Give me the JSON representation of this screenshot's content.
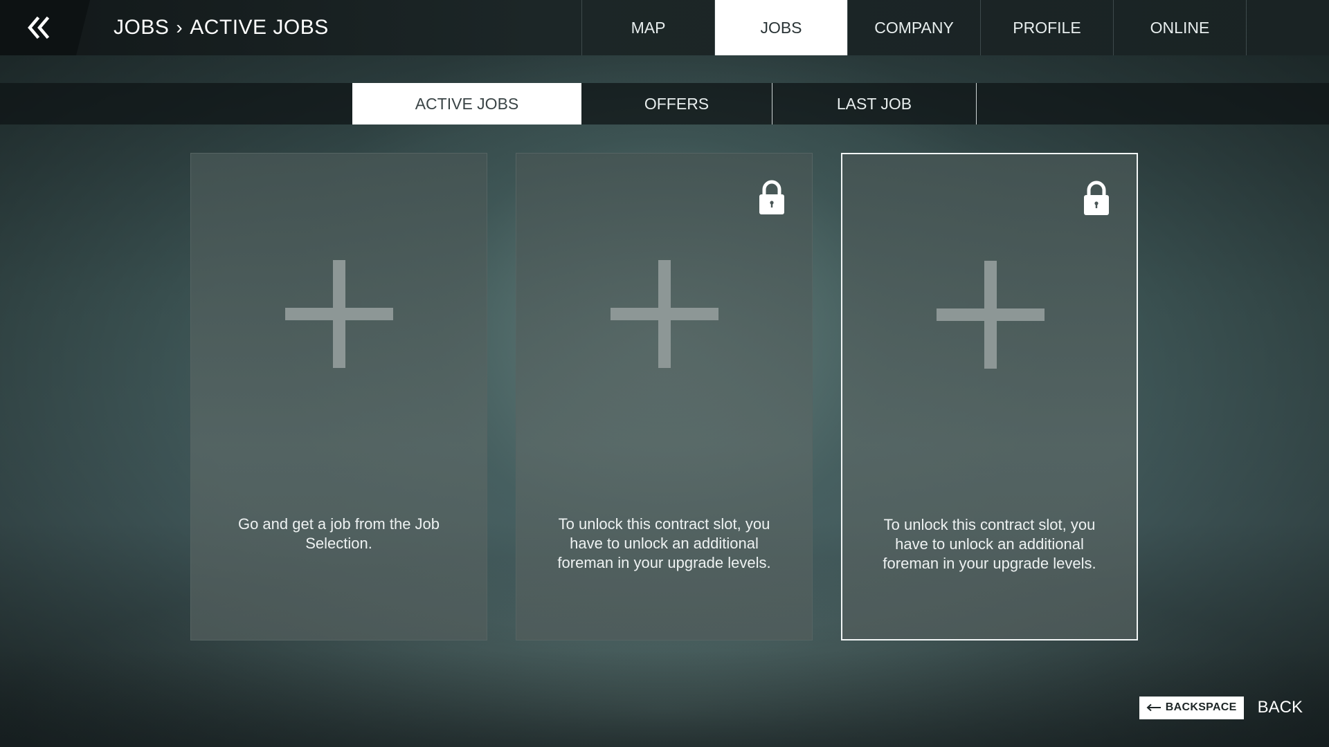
{
  "header": {
    "breadcrumb": [
      "JOBS",
      "ACTIVE JOBS"
    ],
    "breadcrumb_sep": "›",
    "tabs": [
      {
        "label": "MAP"
      },
      {
        "label": "JOBS",
        "active": true
      },
      {
        "label": "COMPANY"
      },
      {
        "label": "PROFILE"
      },
      {
        "label": "ONLINE"
      }
    ]
  },
  "subtabs": [
    {
      "label": "ACTIVE JOBS",
      "active": true
    },
    {
      "label": "OFFERS"
    },
    {
      "label": "LAST JOB"
    }
  ],
  "slots": [
    {
      "message": "Go and get a job from the Job Selection.",
      "locked": false
    },
    {
      "message": "To unlock this contract slot, you have to unlock an additional foreman in your upgrade levels.",
      "locked": true
    },
    {
      "message": "To unlock this contract slot, you have to unlock an additional foreman in your upgrade levels.",
      "locked": true,
      "selected": true
    }
  ],
  "footer": {
    "key_label": "BACKSPACE",
    "action_label": "BACK"
  },
  "icons": {
    "back": "double-chevron-left-icon",
    "lock": "lock-icon",
    "plus": "plus-icon",
    "key_arrow": "arrow-left-icon"
  },
  "colors": {
    "active_tab_bg": "#ffffff",
    "topbar_bg": "#1a2324",
    "plus": "#8d9796"
  }
}
